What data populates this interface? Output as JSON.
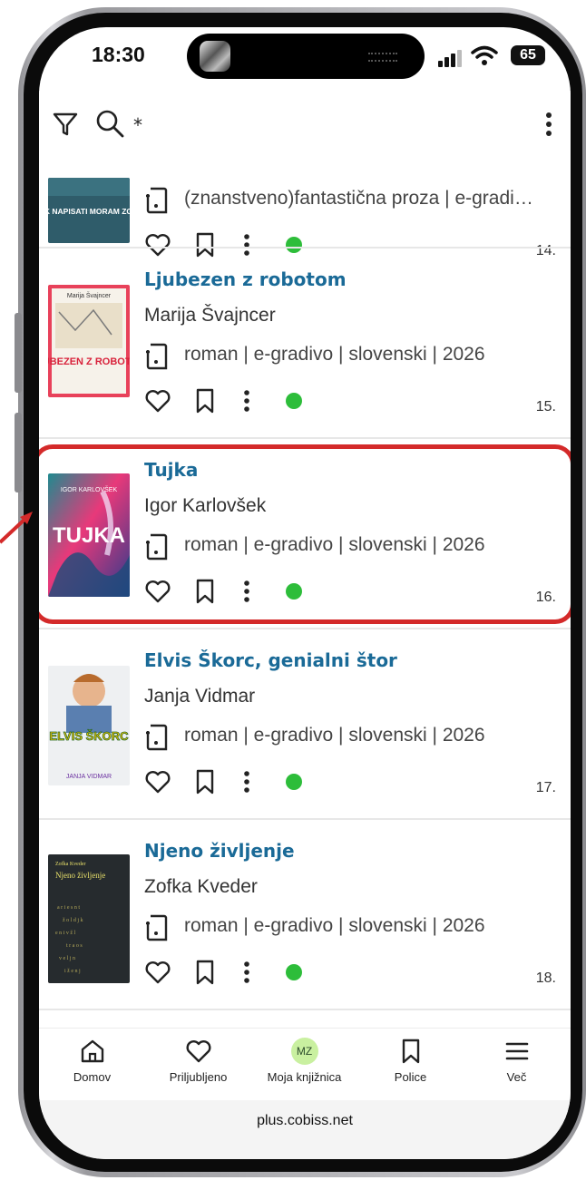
{
  "status_bar": {
    "time": "18:30",
    "battery": "65"
  },
  "toolbar": {
    "search_query": "*"
  },
  "results": [
    {
      "cover_text": "AMPAK NAPISATI MORAM ZGODBO",
      "title": "",
      "author": "",
      "meta": "(znanstveno)fantastična proza | e-gradi…",
      "number": "14."
    },
    {
      "cover_text": "LJUBEZEN Z ROBOTOM",
      "cover_author": "Marija Švajncer",
      "title": "Ljubezen z robotom",
      "author": "Marija Švajncer",
      "meta": "roman | e-gradivo | slovenski | 2026",
      "number": "15."
    },
    {
      "cover_text": "TUJKA",
      "cover_author": "IGOR KARLOVŠEK",
      "title": "Tujka",
      "author": "Igor Karlovšek",
      "meta": "roman | e-gradivo | slovenski | 2026",
      "number": "16.",
      "highlighted": true
    },
    {
      "cover_text": "ELVIS ŠKORC",
      "cover_author": "JANJA VIDMAR",
      "title": "Elvis Škorc, genialni štor",
      "author": "Janja Vidmar",
      "meta": "roman | e-gradivo | slovenski | 2026",
      "number": "17."
    },
    {
      "cover_text": "Njeno življenje",
      "cover_author": "Zofka Kveder",
      "title": "Njeno življenje",
      "author": "Zofka Kveder",
      "meta": "roman | e-gradivo | slovenski | 2026",
      "number": "18."
    }
  ],
  "bottom_nav": {
    "home": "Domov",
    "favorites": "Priljubljeno",
    "avatar_initials": "MZ",
    "library": "Moja knjižnica",
    "shelves": "Police",
    "more": "Več"
  },
  "browser": {
    "url": "plus.cobiss.net"
  },
  "colors": {
    "title": "#1a6a97",
    "status_available": "#2dbd3a",
    "highlight": "#d42a2a"
  }
}
